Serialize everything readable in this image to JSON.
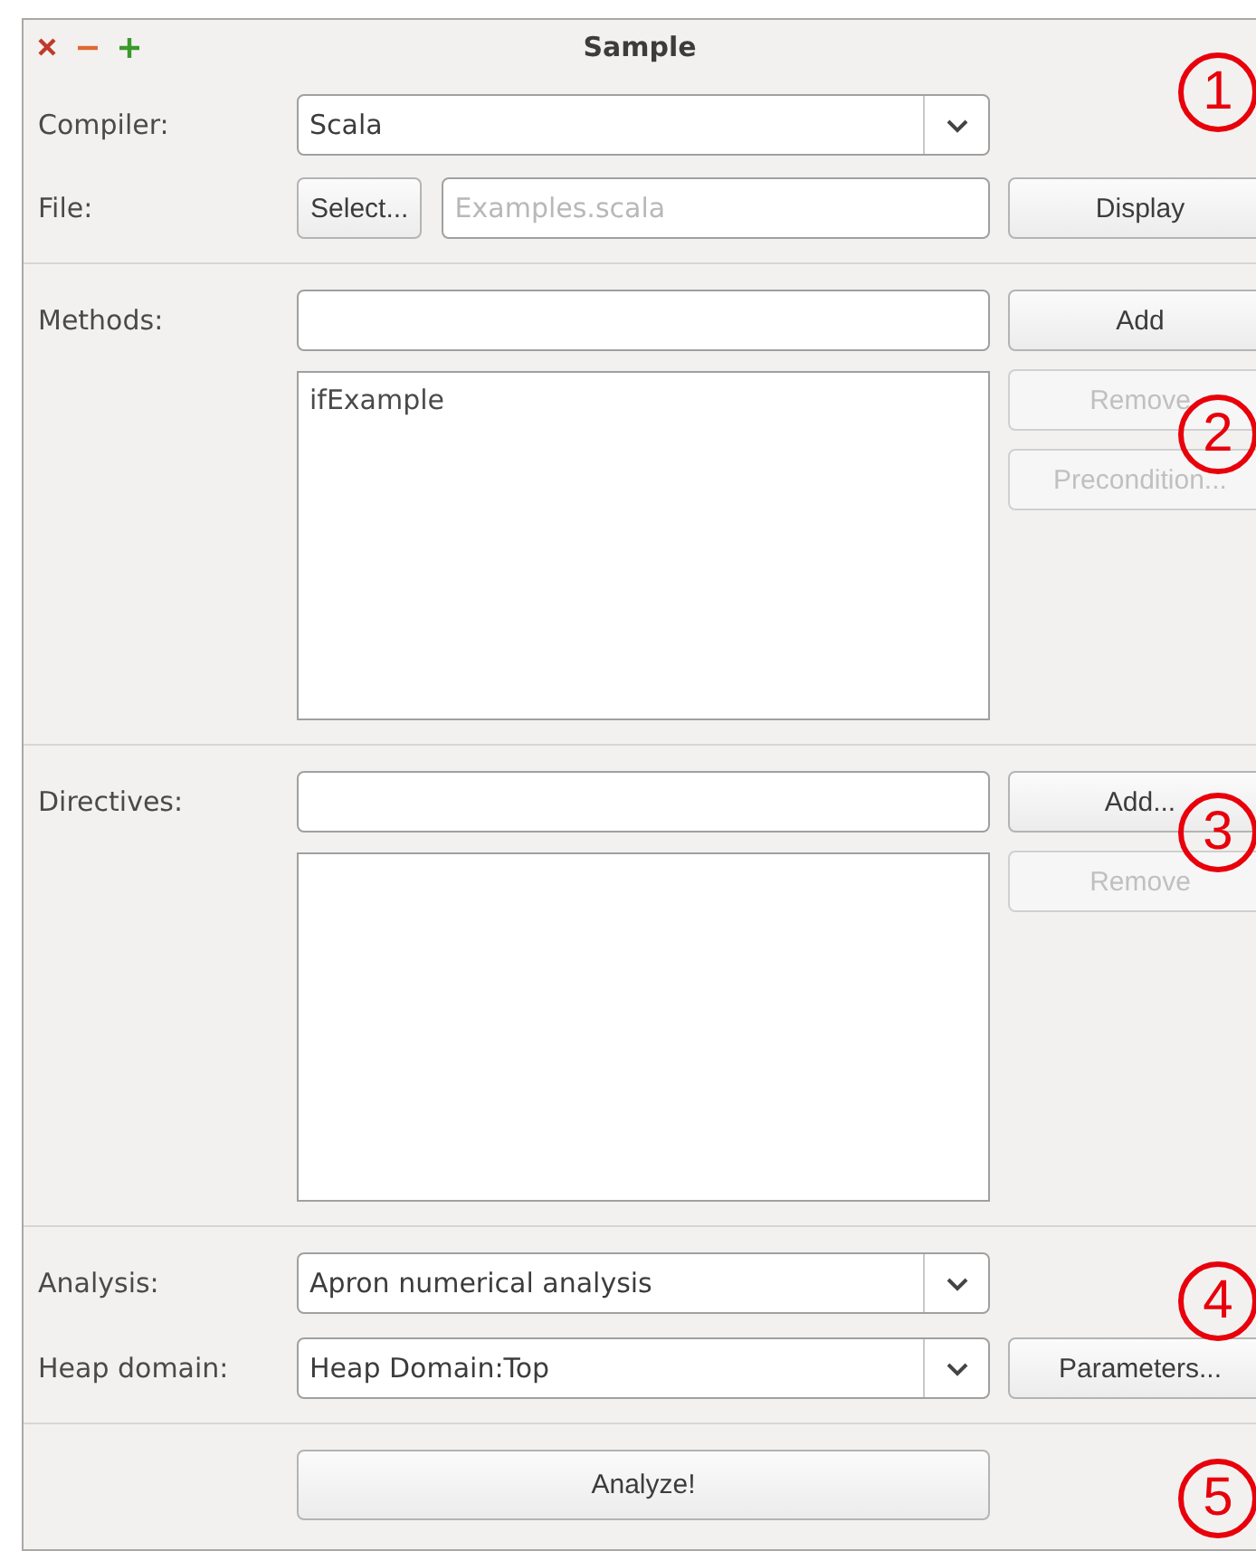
{
  "window": {
    "title": "Sample"
  },
  "compiler": {
    "label": "Compiler:",
    "value": "Scala"
  },
  "file": {
    "label": "File:",
    "select_button": {
      "label": "Select..."
    },
    "field": {
      "placeholder": "Examples.scala"
    },
    "display_button": {
      "label": "Display"
    }
  },
  "methods": {
    "label": "Methods:",
    "list": [
      "ifExample"
    ],
    "buttons": [
      {
        "label": "Add",
        "disabled": false
      },
      {
        "label": "Remove",
        "disabled": true
      },
      {
        "label": "Precondition...",
        "disabled": true
      }
    ]
  },
  "directives": {
    "label": "Directives:",
    "buttons": [
      {
        "label": "Add...",
        "disabled": false
      },
      {
        "label": "Remove",
        "disabled": true
      }
    ]
  },
  "analysis": {
    "label": "Analysis:",
    "value": "Apron numerical analysis"
  },
  "heap_domain": {
    "label": "Heap domain:",
    "value": "Heap Domain:Top",
    "button": {
      "label": "Parameters..."
    }
  },
  "analyze_button": {
    "label": "Analyze!"
  },
  "callouts": [
    "1",
    "2",
    "3",
    "4",
    "5"
  ]
}
